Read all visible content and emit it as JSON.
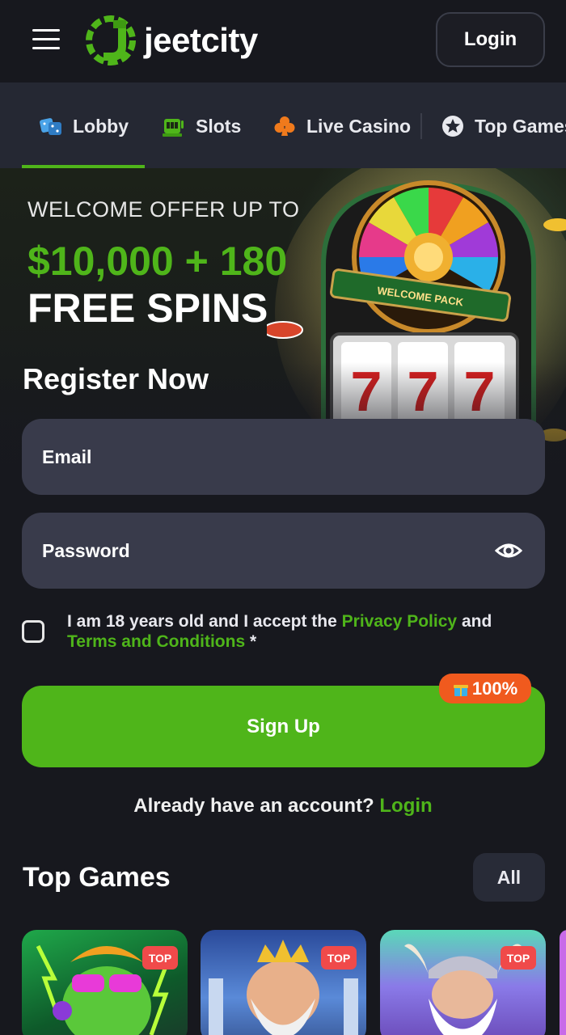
{
  "header": {
    "logo_text": "jeetcity",
    "login_label": "Login"
  },
  "nav": {
    "items": [
      {
        "label": "Lobby",
        "icon": "dice-icon"
      },
      {
        "label": "Slots",
        "icon": "slot-machine-icon"
      },
      {
        "label": "Live Casino",
        "icon": "club-icon"
      },
      {
        "label": "Top Games",
        "icon": "star-icon"
      }
    ],
    "active": "Lobby"
  },
  "hero": {
    "line1": "WELCOME OFFER UP TO",
    "line2": "$10,000 + 180",
    "line3": "FREE SPINS",
    "wheel_text": "WELCOME PACK"
  },
  "register": {
    "title": "Register Now",
    "email_placeholder": "Email",
    "password_placeholder": "Password",
    "terms_prefix": "I am 18 years old and I accept the",
    "privacy_link": "Privacy Policy",
    "and_text": "and",
    "terms_link": "Terms and Conditions",
    "asterisk": "*",
    "signup_label": "Sign Up",
    "bonus_badge": "100%",
    "have_account": "Already have an account?",
    "login_link": "Login"
  },
  "top_games": {
    "title": "Top Games",
    "all_label": "All",
    "cards": [
      {
        "badge": "TOP"
      },
      {
        "badge": "TOP"
      },
      {
        "badge": "TOP"
      }
    ]
  },
  "colors": {
    "background": "#17181e",
    "nav_bg": "#252833",
    "accent_green": "#4fb51a",
    "input_bg": "#393b4b",
    "badge_orange": "#f05a1e",
    "top_badge_red": "#f04a4a"
  }
}
